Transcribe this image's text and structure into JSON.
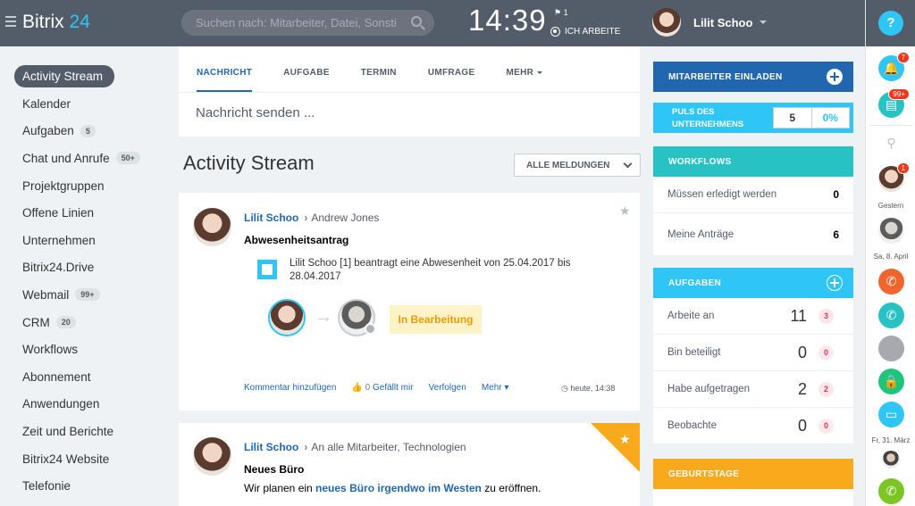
{
  "header": {
    "logo_text": "Bitrix",
    "logo_num": "24",
    "search_placeholder": "Suchen nach: Mitarbeiter, Datei, Sonstiges",
    "clock": "14:39",
    "flag_count": "1",
    "work_status": "ICH ARBEITE",
    "user_name": "Lilit Schoo"
  },
  "rightbar": {
    "help": "?",
    "notify_badge": "7",
    "chat_badge": "99+",
    "contact_badge": "1",
    "label_yesterday": "Gestern",
    "label_date1": "Sa, 8. April",
    "label_date2": "Fr, 31. März"
  },
  "menu": {
    "items": [
      {
        "label": "Activity Stream"
      },
      {
        "label": "Kalender"
      },
      {
        "label": "Aufgaben",
        "badge": "5"
      },
      {
        "label": "Chat und Anrufe",
        "badge": "50+"
      },
      {
        "label": "Projektgruppen"
      },
      {
        "label": "Offene Linien"
      },
      {
        "label": "Unternehmen"
      },
      {
        "label": "Bitrix24.Drive"
      },
      {
        "label": "Webmail",
        "badge": "99+"
      },
      {
        "label": "CRM",
        "badge": "20"
      },
      {
        "label": "Workflows"
      },
      {
        "label": "Abonnement"
      },
      {
        "label": "Anwendungen"
      },
      {
        "label": "Zeit und Berichte"
      },
      {
        "label": "Bitrix24 Website"
      },
      {
        "label": "Telefonie"
      }
    ]
  },
  "composer": {
    "tabs": [
      "NACHRICHT",
      "AUFGABE",
      "TERMIN",
      "UMFRAGE",
      "MEHR"
    ],
    "placeholder": "Nachricht senden ..."
  },
  "stream": {
    "title": "Activity Stream",
    "filter": "ALLE MELDUNGEN"
  },
  "post1": {
    "author": "Lilit Schoo",
    "dest": "Andrew Jones",
    "title": "Abwesenheitsantrag",
    "text": "Lilit Schoo [1] beantragt eine Abwesenheit von 25.04.2017 bis 28.04.2017",
    "status": "In Bearbeitung",
    "comment": "Kommentar hinzufügen",
    "like_count": "0",
    "like": "Gefällt mir",
    "follow": "Verfolgen",
    "more": "Mehr",
    "time": "heute, 14:38"
  },
  "post2": {
    "author": "Lilit Schoo",
    "dest": "An alle Mitarbeiter, Technologien",
    "title": "Neues Büro",
    "text_a": "Wir planen ein ",
    "text_link": "neues Büro irgendwo im Westen",
    "text_b": " zu eröffnen."
  },
  "widgets": {
    "invite": "MITARBEITER EINLADEN",
    "pulse_line1": "PULS DES",
    "pulse_line2": "UNTERNEHMENS",
    "pulse_value": "5",
    "pulse_percent": "0%",
    "workflows_title": "WORKFLOWS",
    "workflows": [
      {
        "label": "Müssen erledigt werden",
        "value": "0"
      },
      {
        "label": "Meine Anträge",
        "value": "6"
      }
    ],
    "tasks_title": "AUFGABEN",
    "tasks": [
      {
        "label": "Arbeite an",
        "value": "11",
        "count": "3"
      },
      {
        "label": "Bin beteiligt",
        "value": "0",
        "count": "0"
      },
      {
        "label": "Habe aufgetragen",
        "value": "2",
        "count": "2"
      },
      {
        "label": "Beobachte",
        "value": "0",
        "count": "0"
      }
    ],
    "birthdays_title": "GEBURTSTAGE"
  },
  "colors": {
    "header": "#535c69",
    "accent_blue": "#2067b0",
    "accent_cyan": "#2fc6f6",
    "teal": "#29c2c4",
    "orange": "#f8a91c",
    "status_bg": "#fef3c7"
  }
}
